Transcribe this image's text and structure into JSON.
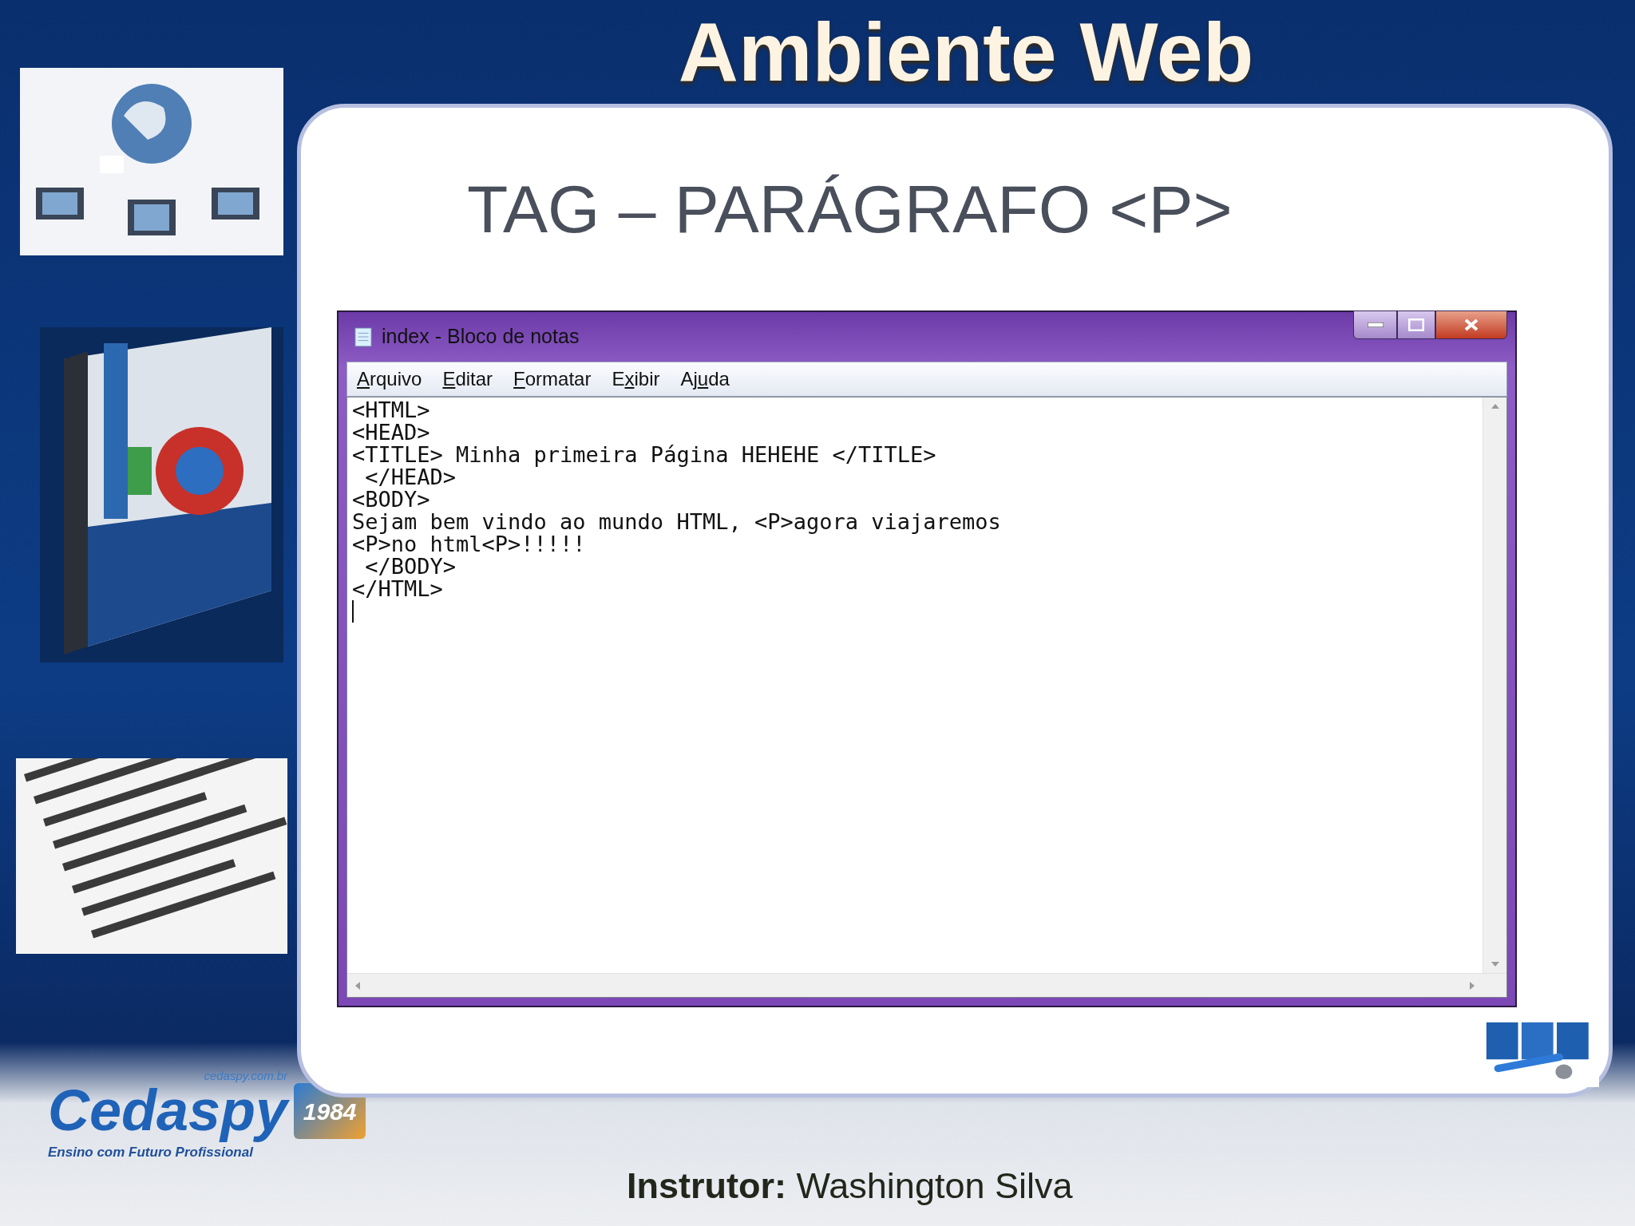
{
  "slide": {
    "title": "Ambiente Web",
    "heading": "TAG – PARÁGRAFO <P>"
  },
  "notepad": {
    "title": "index - Bloco de notas",
    "menu": [
      {
        "key": "A",
        "after": "rquivo"
      },
      {
        "key": "E",
        "after": "ditar"
      },
      {
        "key": "F",
        "after": "ormatar"
      },
      {
        "before": "E",
        "key": "x",
        "after": "ibir"
      },
      {
        "before": "Aj",
        "key": "u",
        "after": "da"
      }
    ],
    "lines": [
      "<HTML>",
      "<HEAD>",
      "<TITLE> Minha primeira Página HEHEHE </TITLE>",
      " </HEAD>",
      "<BODY>",
      "Sejam bem vindo ao mundo HTML, <P>agora viajaremos",
      "<P>no html<P>!!!!!",
      " </BODY>",
      "</HTML>"
    ]
  },
  "logo": {
    "url": "cedaspy.com.br",
    "name": "Cedaspy",
    "badge": "1984",
    "tagline": "Ensino com Futuro Profissional"
  },
  "footer": {
    "label": "Instrutor:",
    "name": "Washington Silva"
  }
}
